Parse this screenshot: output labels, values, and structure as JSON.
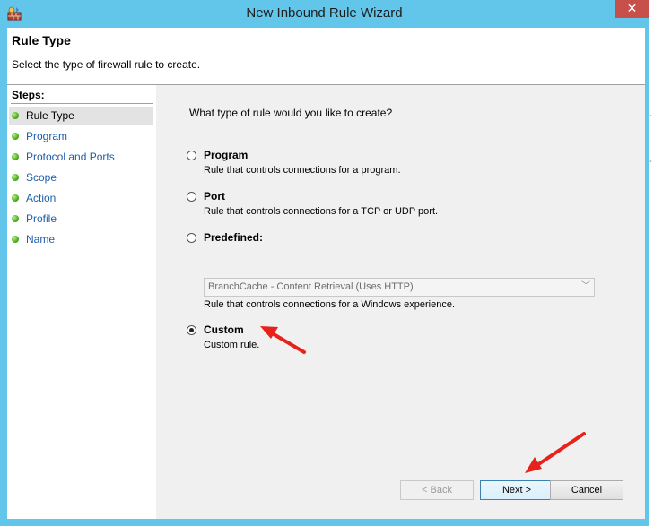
{
  "window": {
    "title": "New Inbound Rule Wizard",
    "close_symbol": "✕",
    "title_bar_color": "#62c6ea",
    "close_color": "#c7504b"
  },
  "header": {
    "title": "Rule Type",
    "subtitle": "Select the type of firewall rule to create."
  },
  "steps": {
    "title": "Steps:",
    "items": [
      {
        "label": "Rule Type",
        "current": true
      },
      {
        "label": "Program",
        "current": false
      },
      {
        "label": "Protocol and Ports",
        "current": false
      },
      {
        "label": "Scope",
        "current": false
      },
      {
        "label": "Action",
        "current": false
      },
      {
        "label": "Profile",
        "current": false
      },
      {
        "label": "Name",
        "current": false
      }
    ],
    "dot_icon": "green-bullet-icon"
  },
  "content": {
    "question": "What type of rule would you like to create?",
    "options": [
      {
        "label": "Program",
        "description": "Rule that controls connections for a program.",
        "selected": false
      },
      {
        "label": "Port",
        "description": "Rule that controls connections for a TCP or UDP port.",
        "selected": false
      },
      {
        "label": "Predefined:",
        "description": "Rule that controls connections for a Windows experience.",
        "selected": false
      },
      {
        "label": "Custom",
        "description": "Custom rule.",
        "selected": true
      }
    ],
    "predefined_select": {
      "value": "BranchCache - Content Retrieval (Uses HTTP)",
      "enabled": false
    }
  },
  "buttons": {
    "back": "< Back",
    "next": "Next >",
    "cancel": "Cancel"
  },
  "annotations": {
    "arrow_color": "#e8221b"
  }
}
